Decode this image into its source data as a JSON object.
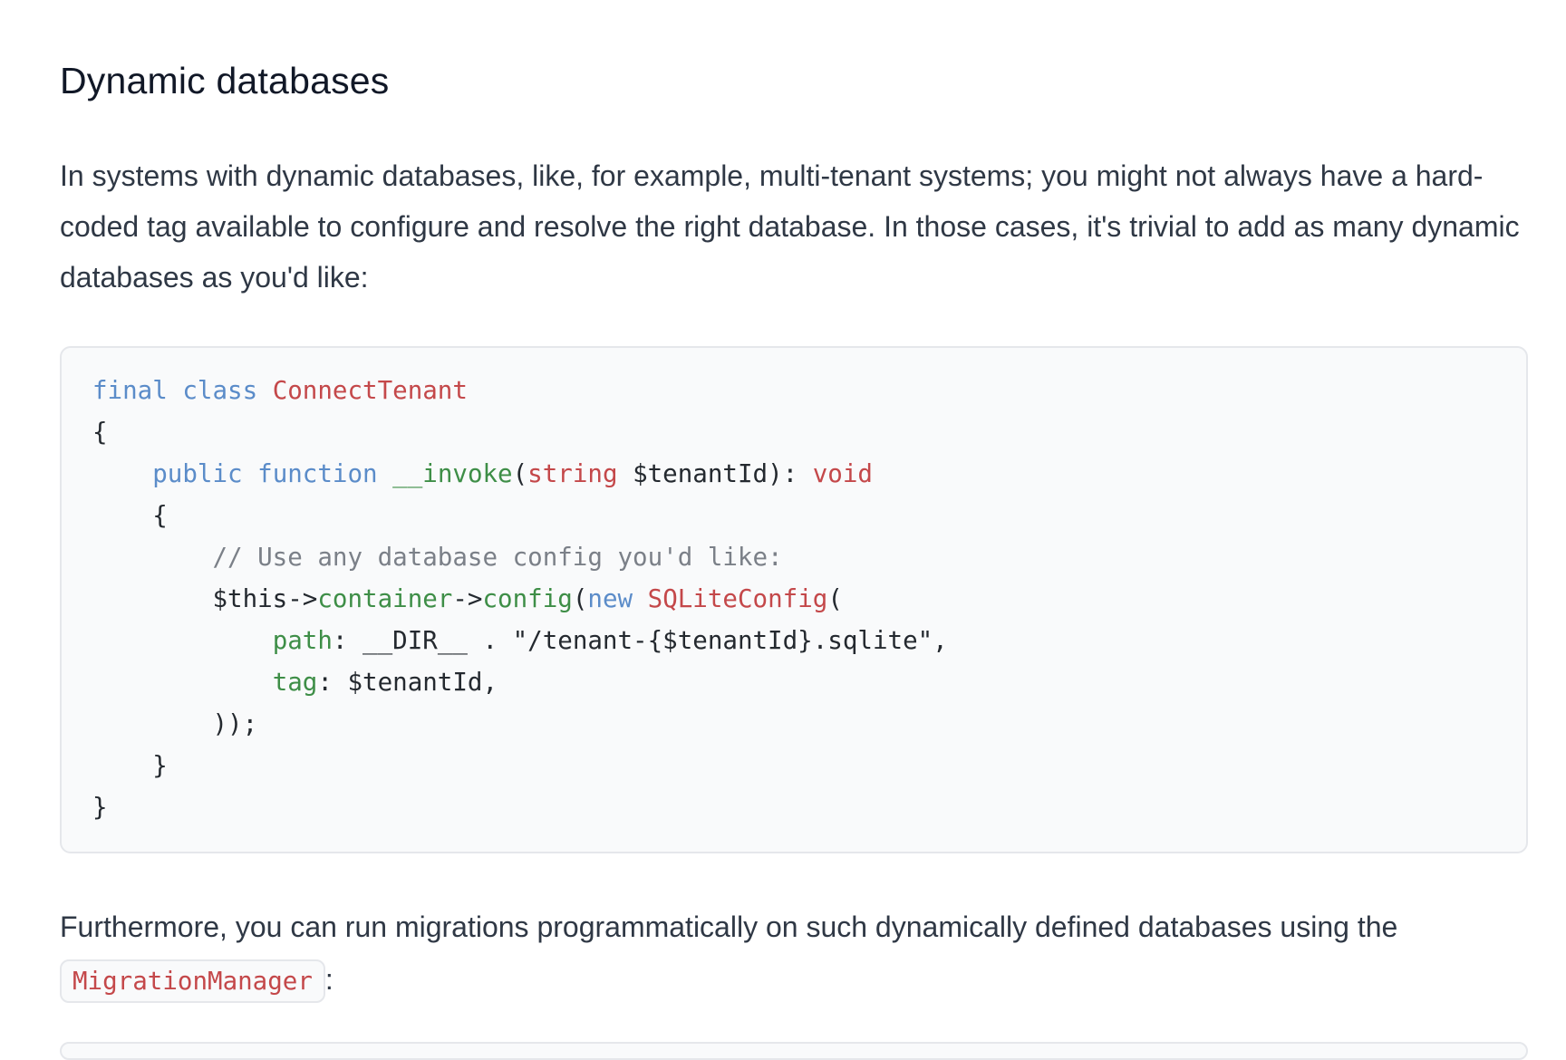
{
  "heading": "Dynamic databases",
  "intro": "In systems with dynamic databases, like, for example, multi-tenant systems; you might not always have a hard-coded tag available to configure and resolve the right database. In those cases, it's trivial to add as many dynamic databases as you'd like:",
  "code": {
    "lines": [
      [
        {
          "t": "final ",
          "c": "kw"
        },
        {
          "t": "class ",
          "c": "kw"
        },
        {
          "t": "ConnectTenant",
          "c": "cls"
        }
      ],
      [
        {
          "t": "{",
          "c": "plain"
        }
      ],
      [
        {
          "t": "    ",
          "c": "plain"
        },
        {
          "t": "public ",
          "c": "kw"
        },
        {
          "t": "function ",
          "c": "kw"
        },
        {
          "t": "__invoke",
          "c": "fn"
        },
        {
          "t": "(",
          "c": "plain"
        },
        {
          "t": "string",
          "c": "cls"
        },
        {
          "t": " $tenantId): ",
          "c": "plain"
        },
        {
          "t": "void",
          "c": "cls"
        }
      ],
      [
        {
          "t": "    {",
          "c": "plain"
        }
      ],
      [
        {
          "t": "        ",
          "c": "plain"
        },
        {
          "t": "// Use any database config you'd like:",
          "c": "com"
        }
      ],
      [
        {
          "t": "        $this->",
          "c": "plain"
        },
        {
          "t": "container",
          "c": "fn"
        },
        {
          "t": "->",
          "c": "plain"
        },
        {
          "t": "config",
          "c": "fn"
        },
        {
          "t": "(",
          "c": "plain"
        },
        {
          "t": "new ",
          "c": "kw"
        },
        {
          "t": "SQLiteConfig",
          "c": "cls"
        },
        {
          "t": "(",
          "c": "plain"
        }
      ],
      [
        {
          "t": "            ",
          "c": "plain"
        },
        {
          "t": "path",
          "c": "fn"
        },
        {
          "t": ": __DIR__ . \"/tenant-{$tenantId}.sqlite\",",
          "c": "plain"
        }
      ],
      [
        {
          "t": "            ",
          "c": "plain"
        },
        {
          "t": "tag",
          "c": "fn"
        },
        {
          "t": ": $tenantId,",
          "c": "plain"
        }
      ],
      [
        {
          "t": "        ));",
          "c": "plain"
        }
      ],
      [
        {
          "t": "    }",
          "c": "plain"
        }
      ],
      [
        {
          "t": "}",
          "c": "plain"
        }
      ]
    ]
  },
  "outro": {
    "text_before": "Furthermore, you can run migrations programmatically on such dynamically defined databases using the",
    "inline_code": "MigrationManager",
    "text_after": ":"
  },
  "colors": {
    "keyword": "#5b8cc9",
    "class_type": "#c4484a",
    "function_property": "#3e8e47",
    "comment": "#7b8088",
    "plain": "#24292f",
    "code_background": "#f9fafb",
    "code_border": "#e5e7eb"
  }
}
